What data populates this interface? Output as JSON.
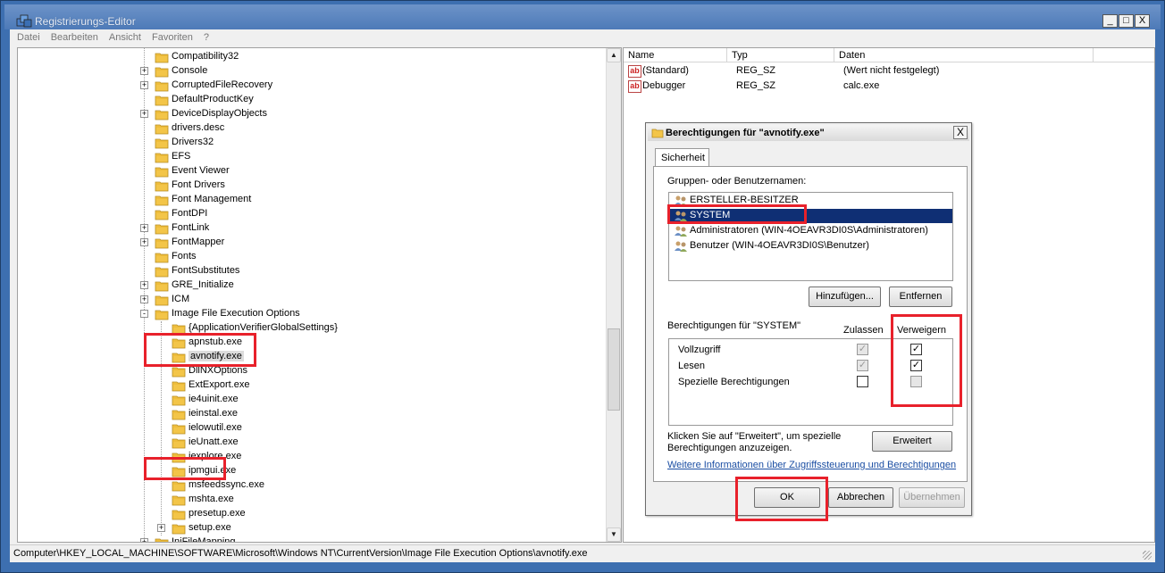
{
  "window": {
    "title": "Registrierungs-Editor",
    "controls": [
      "_",
      "□",
      "X"
    ]
  },
  "menu": [
    "Datei",
    "Bearbeiten",
    "Ansicht",
    "Favoriten",
    "?"
  ],
  "tree": {
    "items": [
      {
        "label": "Compatibility32",
        "exp": ""
      },
      {
        "label": "Console",
        "exp": "+"
      },
      {
        "label": "CorruptedFileRecovery",
        "exp": "+"
      },
      {
        "label": "DefaultProductKey",
        "exp": ""
      },
      {
        "label": "DeviceDisplayObjects",
        "exp": "+"
      },
      {
        "label": "drivers.desc",
        "exp": ""
      },
      {
        "label": "Drivers32",
        "exp": ""
      },
      {
        "label": "EFS",
        "exp": ""
      },
      {
        "label": "Event Viewer",
        "exp": ""
      },
      {
        "label": "Font Drivers",
        "exp": ""
      },
      {
        "label": "Font Management",
        "exp": ""
      },
      {
        "label": "FontDPI",
        "exp": ""
      },
      {
        "label": "FontLink",
        "exp": "+"
      },
      {
        "label": "FontMapper",
        "exp": "+"
      },
      {
        "label": "Fonts",
        "exp": ""
      },
      {
        "label": "FontSubstitutes",
        "exp": ""
      },
      {
        "label": "GRE_Initialize",
        "exp": "+"
      },
      {
        "label": "ICM",
        "exp": "+"
      },
      {
        "label": "Image File Execution Options",
        "exp": "-"
      }
    ],
    "children": [
      {
        "label": "{ApplicationVerifierGlobalSettings}",
        "exp": ""
      },
      {
        "label": "apnstub.exe",
        "exp": ""
      },
      {
        "label": "avnotify.exe",
        "exp": "",
        "selected": true
      },
      {
        "label": "DllNXOptions",
        "exp": ""
      },
      {
        "label": "ExtExport.exe",
        "exp": ""
      },
      {
        "label": "ie4uinit.exe",
        "exp": ""
      },
      {
        "label": "ieinstal.exe",
        "exp": ""
      },
      {
        "label": "ielowutil.exe",
        "exp": ""
      },
      {
        "label": "ieUnatt.exe",
        "exp": ""
      },
      {
        "label": "iexplore.exe",
        "exp": ""
      },
      {
        "label": "ipmgui.exe",
        "exp": ""
      },
      {
        "label": "msfeedssync.exe",
        "exp": ""
      },
      {
        "label": "mshta.exe",
        "exp": ""
      },
      {
        "label": "presetup.exe",
        "exp": ""
      },
      {
        "label": "setup.exe",
        "exp": "+"
      }
    ],
    "last": {
      "label": "IniFileMapping",
      "exp": "+"
    },
    "scroll_up": "▲",
    "scroll_down": "▼"
  },
  "values": {
    "columns": [
      "Name",
      "Typ",
      "Daten"
    ],
    "rows": [
      {
        "name": "(Standard)",
        "type": "REG_SZ",
        "data": "(Wert nicht festgelegt)",
        "icon": "ab"
      },
      {
        "name": "Debugger",
        "type": "REG_SZ",
        "data": "calc.exe",
        "icon": "ab"
      }
    ]
  },
  "statusbar": {
    "path": "Computer\\HKEY_LOCAL_MACHINE\\SOFTWARE\\Microsoft\\Windows NT\\CurrentVersion\\Image File Execution Options\\avnotify.exe"
  },
  "dialog": {
    "title": "Berechtigungen für \"avnotify.exe\"",
    "close": "X",
    "tab": "Sicherheit",
    "groups_label": "Gruppen- oder Benutzernamen:",
    "users": [
      {
        "name": "ERSTELLER-BESITZER",
        "selected": false
      },
      {
        "name": "SYSTEM",
        "selected": true
      },
      {
        "name": "Administratoren (WIN-4OEAVR3DI0S\\Administratoren)",
        "selected": false
      },
      {
        "name": "Benutzer (WIN-4OEAVR3DI0S\\Benutzer)",
        "selected": false
      }
    ],
    "add_button": "Hinzufügen...",
    "remove_button": "Entfernen",
    "perm_label": "Berechtigungen für \"SYSTEM\"",
    "allow_header": "Zulassen",
    "deny_header": "Verweigern",
    "permissions": [
      {
        "name": "Vollzugriff",
        "allow": true,
        "allow_disabled": true,
        "deny": true
      },
      {
        "name": "Lesen",
        "allow": true,
        "allow_disabled": true,
        "deny": true
      },
      {
        "name": "Spezielle Berechtigungen",
        "allow": false,
        "allow_disabled": false,
        "deny": false,
        "deny_disabled": true
      }
    ],
    "advanced_text_1": "Klicken Sie auf \"Erweitert\", um spezielle",
    "advanced_text_2": "Berechtigungen anzuzeigen.",
    "advanced_button": "Erweitert",
    "info_link": "Weitere Informationen über Zugriffssteuerung und Berechtigungen",
    "ok_button": "OK",
    "cancel_button": "Abbrechen",
    "apply_button": "Übernehmen",
    "check_glyph": "✓"
  },
  "colors": {
    "annotation": "#e8212b",
    "selection": "#0f2f74",
    "link": "#1b4ea3"
  }
}
